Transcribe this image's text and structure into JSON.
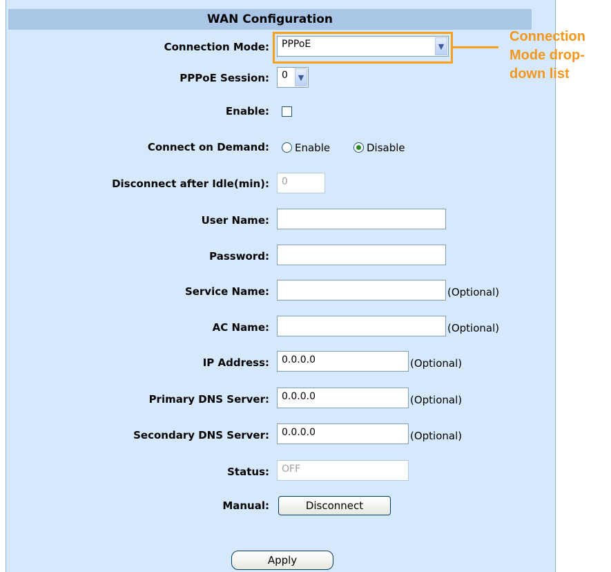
{
  "header": {
    "title": "WAN Configuration"
  },
  "form": {
    "connection_mode": {
      "label": "Connection Mode:",
      "value": "PPPoE"
    },
    "pppoe_session": {
      "label": "PPPoE Session:",
      "value": "0"
    },
    "enable": {
      "label": "Enable:",
      "checked": false
    },
    "connect_on_demand": {
      "label": "Connect on Demand:",
      "options": [
        "Enable",
        "Disable"
      ],
      "selected": "Disable"
    },
    "disconnect_idle": {
      "label": "Disconnect after Idle(min):",
      "value": "0"
    },
    "user_name": {
      "label": "User Name:",
      "value": ""
    },
    "password": {
      "label": "Password:",
      "value": ""
    },
    "service_name": {
      "label": "Service Name:",
      "value": "",
      "hint": "(Optional)"
    },
    "ac_name": {
      "label": "AC Name:",
      "value": "",
      "hint": "(Optional)"
    },
    "ip_address": {
      "label": "IP Address:",
      "value": "0.0.0.0",
      "hint": "(Optional)"
    },
    "primary_dns": {
      "label": "Primary DNS Server:",
      "value": "0.0.0.0",
      "hint": "(Optional)"
    },
    "secondary_dns": {
      "label": "Secondary DNS Server:",
      "value": "0.0.0.0",
      "hint": "(Optional)"
    },
    "status": {
      "label": "Status:",
      "value": "OFF"
    },
    "manual": {
      "label": "Manual:",
      "button": "Disconnect"
    },
    "apply_button": "Apply"
  },
  "annotation": {
    "text_line1": "Connection",
    "text_line2": "Mode drop-",
    "text_line3": "down list",
    "color": "#f5961c"
  }
}
